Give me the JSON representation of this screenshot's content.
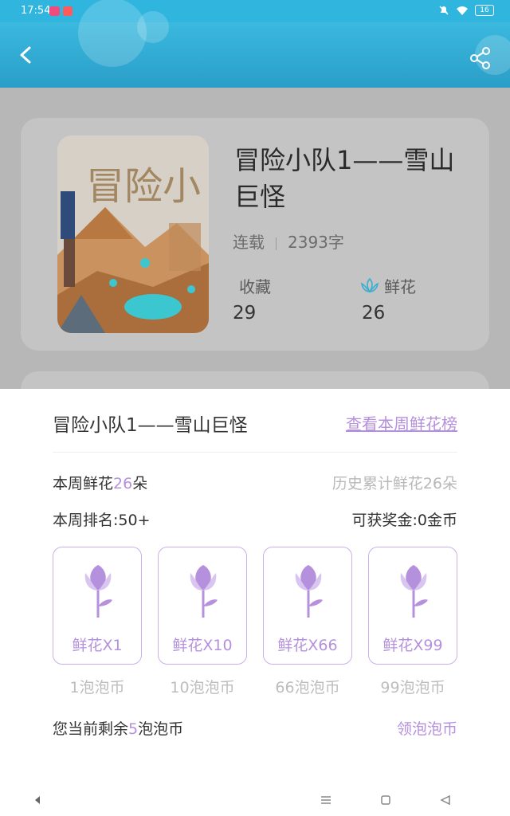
{
  "status": {
    "time": "17:54",
    "battery": "16"
  },
  "book": {
    "title": "冒险小队1——雪山巨怪",
    "status": "连载",
    "word_count": "2393字",
    "collect_label": "收藏",
    "collect_value": "29",
    "flower_label": "鲜花",
    "flower_value": "26",
    "cover_text": "冒险小"
  },
  "sheet": {
    "title": "冒险小队1——雪山巨怪",
    "rank_link": "查看本周鲜花榜",
    "week_flowers_prefix": "本周鲜花",
    "week_flowers_count": "26",
    "week_flowers_suffix": "朵",
    "history": "历史累计鲜花26朵",
    "week_rank": "本周排名:50+",
    "reward": "可获奖金:0金币",
    "gifts": [
      {
        "label": "鲜花X1",
        "price": "1泡泡币"
      },
      {
        "label": "鲜花X10",
        "price": "10泡泡币"
      },
      {
        "label": "鲜花X66",
        "price": "66泡泡币"
      },
      {
        "label": "鲜花X99",
        "price": "99泡泡币"
      }
    ],
    "remain_prefix": "您当前剩余",
    "remain_count": "5",
    "remain_suffix": "泡泡币",
    "collect_coins": "领泡泡币"
  },
  "colors": {
    "accent": "#b590dd",
    "header": "#2fb5de"
  }
}
